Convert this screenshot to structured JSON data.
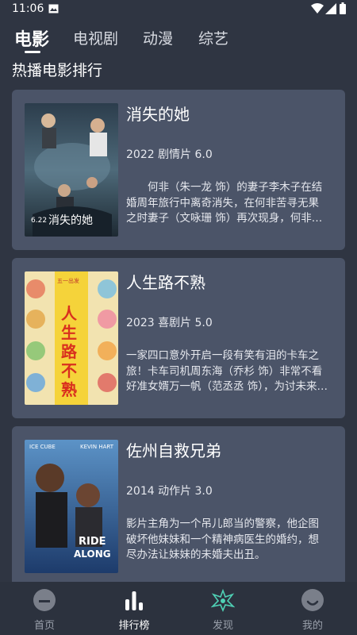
{
  "status_bar": {
    "time": "11:06"
  },
  "tabs": [
    {
      "label": "电影",
      "active": true
    },
    {
      "label": "电视剧",
      "active": false
    },
    {
      "label": "动漫",
      "active": false
    },
    {
      "label": "综艺",
      "active": false
    }
  ],
  "section_title": "热播电影排行",
  "movies": [
    {
      "title": "消失的她",
      "meta": "2022 剧情片 6.0",
      "description": "　　何非（朱一龙 饰）的妻子李木子在结婚周年旅行中离奇消失，在何非苦寻无果之时妻子（文咏珊 饰）再次现身，何非却坚持眼前的陌生女人并非妻子…",
      "poster_text": "6.22 消失的她"
    },
    {
      "title": "人生路不熟",
      "meta": "2023 喜剧片 5.0",
      "description": "一家四口意外开启一段有笑有泪的卡车之旅！卡车司机周东海（乔杉 饰）非常不看好准女婿万一帆（范丞丞 饰），为讨未来岳父欢心，万一帆越努力越“翻…",
      "poster_text": "人生路不熟"
    },
    {
      "title": "佐州自救兄弟",
      "meta": "2014 动作片 3.0",
      "description": "影片主角为一个吊儿郎当的警察，他企图破坏他妹妹和一个精神病医生的婚约，想尽办法让妹妹的未婚夫出丑。",
      "poster_text": "RIDE ALONG"
    }
  ],
  "bottom_nav": [
    {
      "label": "首页",
      "icon": "home-icon",
      "active": false
    },
    {
      "label": "排行榜",
      "icon": "ranking-icon",
      "active": true
    },
    {
      "label": "发现",
      "icon": "discover-icon",
      "active": false
    },
    {
      "label": "我的",
      "icon": "profile-icon",
      "active": false
    }
  ],
  "colors": {
    "background": "#2f3542",
    "card": "#4b5468",
    "text": "#ffffff",
    "muted": "#9aa0ab"
  }
}
